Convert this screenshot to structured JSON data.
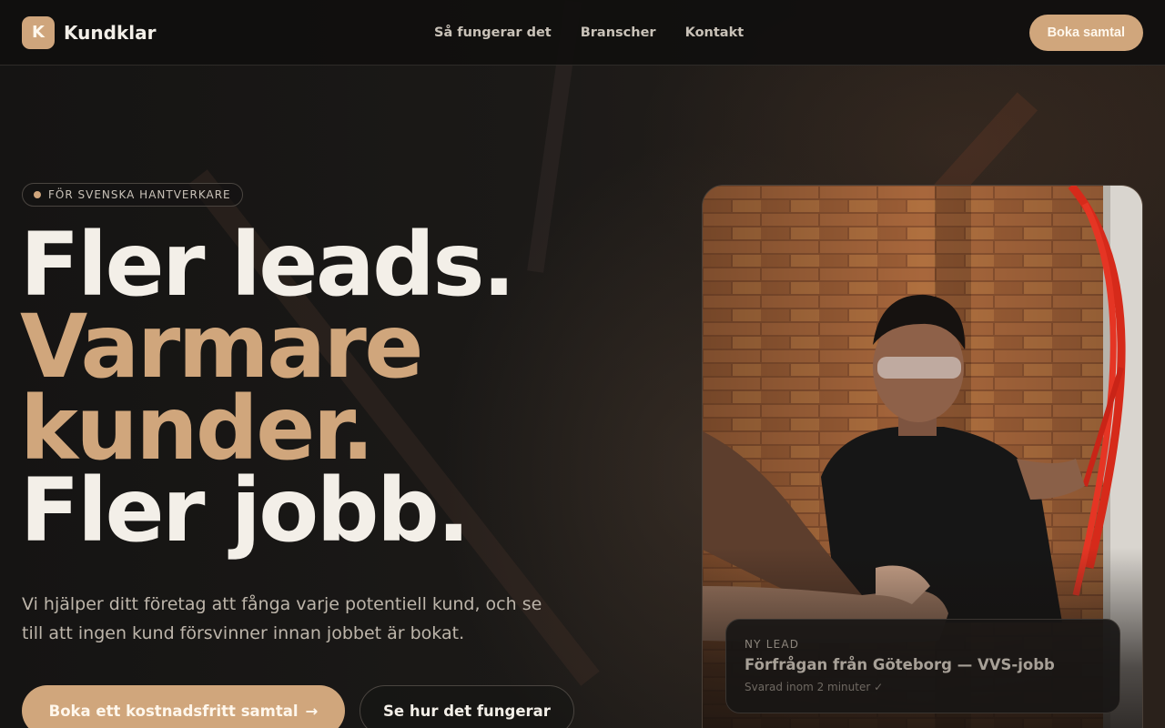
{
  "brand": {
    "logo_letter": "K",
    "name": "Kundklar",
    "accent": "#d0a67c"
  },
  "nav": {
    "items": [
      {
        "label": "Så fungerar det"
      },
      {
        "label": "Branscher"
      },
      {
        "label": "Kontakt"
      }
    ]
  },
  "header": {
    "cta_label": "Boka samtal"
  },
  "hero": {
    "badge": "FÖR SVENSKA HANTVERKARE",
    "headline": {
      "line1": "Fler leads.",
      "line2": "Varmare",
      "line3": "kunder.",
      "line4": "Fler jobb."
    },
    "lede": "Vi hjälper ditt företag att fånga varje potentiell kund, och se till att ingen kund försvinner innan jobbet är bokat.",
    "primary_cta": "Boka ett kostnadsfritt samtal",
    "primary_cta_arrow": "→",
    "secondary_cta": "Se hur det fungerar"
  },
  "lead_card": {
    "tag": "NY LEAD",
    "title": "Förfrågan från Göteborg — VVS-jobb",
    "meta": "Svarad inom 2 minuter ✓"
  }
}
